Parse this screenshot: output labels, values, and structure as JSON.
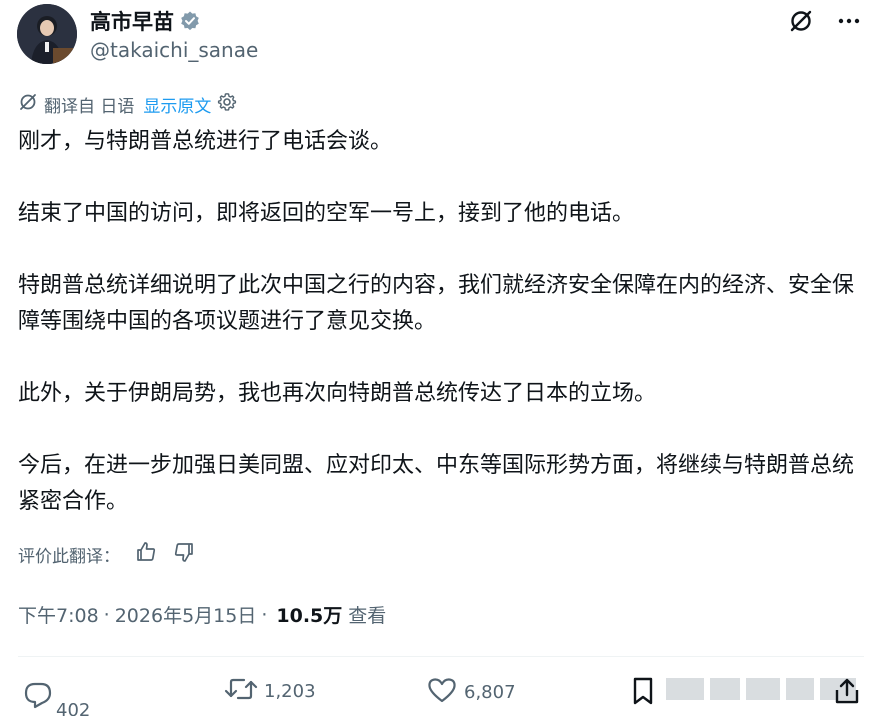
{
  "user": {
    "display_name": "高市早苗",
    "handle": "@takaichi_sanae",
    "verified": true
  },
  "header_icons": [
    "grok-icon",
    "more-icon"
  ],
  "translation": {
    "label": "翻译自 日语",
    "show_original": "显示原文"
  },
  "tweet": {
    "paragraphs": [
      "刚才，与特朗普总统进行了电话会谈。",
      "结束了中国的访问，即将返回的空军一号上，接到了他的电话。",
      "特朗普总统详细说明了此次中国之行的内容，我们就经济安全保障在内的经济、安全保障等围绕中国的各项议题进行了意见交换。",
      "此外，关于伊朗局势，我也再次向特朗普总统传达了日本的立场。",
      "今后，在进一步加强日美同盟、应对印太、中东等国际形势方面，将继续与特朗普总统紧密合作。"
    ]
  },
  "rate_translation": {
    "label": "评价此翻译："
  },
  "meta": {
    "time": "下午7:08",
    "date": "2026年5月15日",
    "views": "10.5万",
    "views_label": "查看"
  },
  "actions": {
    "replies": "402",
    "reposts": "1,203",
    "likes": "6,807"
  },
  "colors": {
    "text_primary": "#0f1419",
    "text_secondary": "#536471",
    "link": "#1d9bf0",
    "verified_badge": "#829aab"
  }
}
